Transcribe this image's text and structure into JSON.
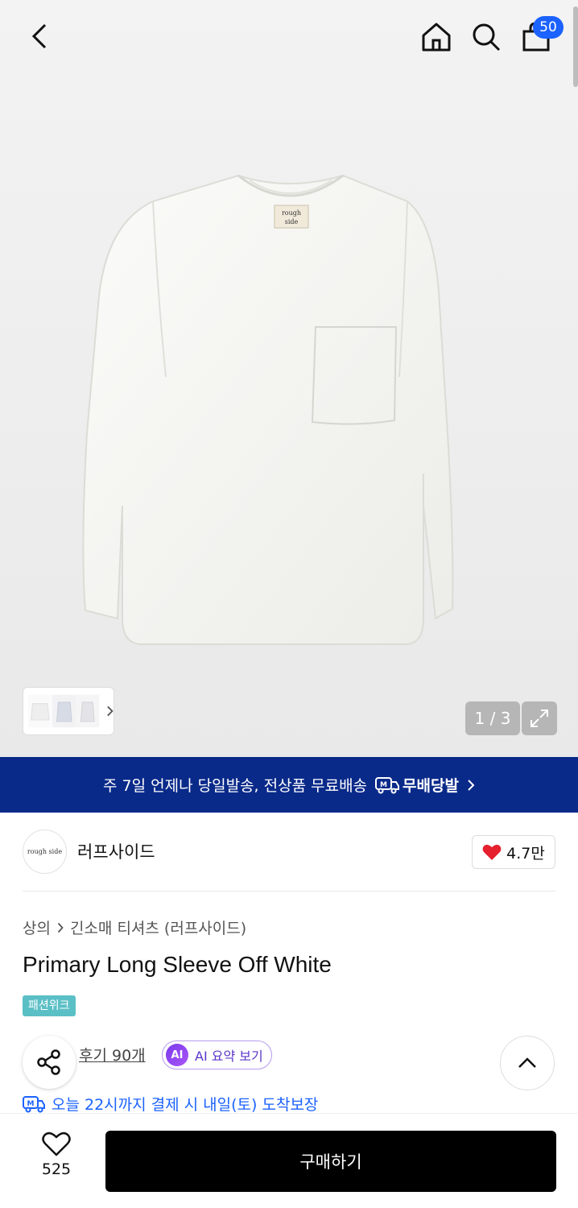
{
  "header": {
    "back_icon": "chevron-left-icon",
    "home_icon": "home-icon",
    "search_icon": "search-icon",
    "cart_icon": "shopping-bag-icon",
    "cart_count": "50"
  },
  "gallery": {
    "thumb_logo_line1": "rough",
    "thumb_logo_line2": "side",
    "counter": "1 / 3",
    "expand_icon": "expand-icon"
  },
  "banner": {
    "text": "주 7일 언제나 당일발송, 전상품 무료배송",
    "service_label": "무배당발",
    "service_logo": "M"
  },
  "brand": {
    "logo_text": "rough side",
    "name": "러프사이드",
    "like_count": "4.7만"
  },
  "product": {
    "breadcrumb": [
      "상의",
      "긴소매 티셔츠 (러프사이드)"
    ],
    "title": "Primary Long Sleeve Off White",
    "tag": "패션위크",
    "review_link": "후기 90개",
    "ai_badge": "AI",
    "ai_label": "AI 요약 보기",
    "delivery_note": "오늘 22시까지 결제 시 내일(토) 도착보장",
    "delivery_logo": "M"
  },
  "bottom": {
    "wish_count": "525",
    "buy_label": "구매하기"
  },
  "colors": {
    "banner_bg": "#0a2a8a",
    "badge_blue": "#1b62ff",
    "tag_teal": "#5bbfc6",
    "heart_red": "#e5212d",
    "ai_purple": "#7c3aed"
  }
}
